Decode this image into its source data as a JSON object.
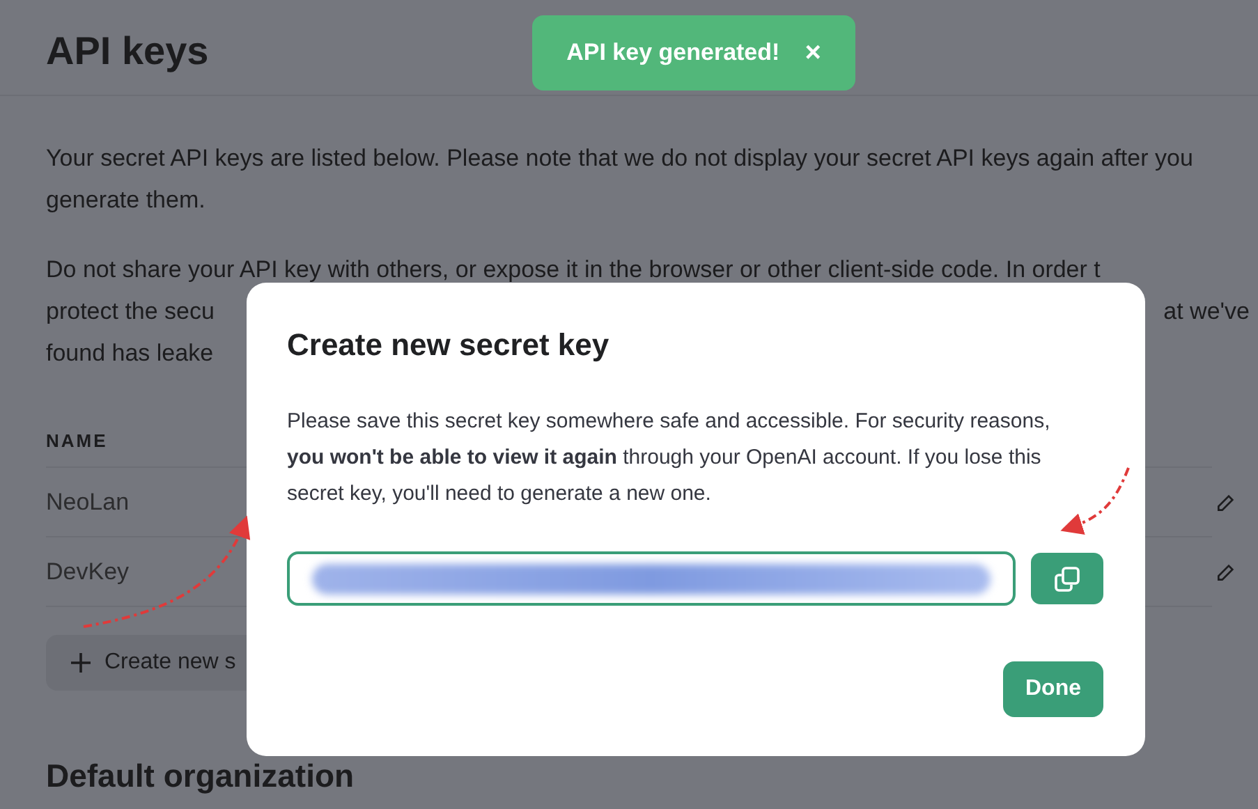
{
  "page": {
    "title": "API keys",
    "intro": "Your secret API keys are listed below. Please note that we do not display your secret API keys again after you generate them.",
    "warning_lines": [
      {
        "left": "Do not share your API key with others, or expose it in the browser or other client-side code. In order t"
      },
      {
        "left": "protect the secu",
        "right": "at we've"
      },
      {
        "left": "found has leake"
      }
    ],
    "table": {
      "columns": [
        "NAME"
      ],
      "rows": [
        {
          "name": "NeoLan"
        },
        {
          "name": "DevKey"
        }
      ]
    },
    "create_button": "Create new s",
    "section_title": "Default organization"
  },
  "toast": {
    "text": "API key generated!",
    "close": "×"
  },
  "dialog": {
    "title": "Create new secret key",
    "body": "Please save this secret key somewhere safe and accessible. For security reasons, **you won't be able to view it again** through your OpenAI account. If you lose this secret key, you'll need to generate a new one.",
    "done": "Done"
  }
}
